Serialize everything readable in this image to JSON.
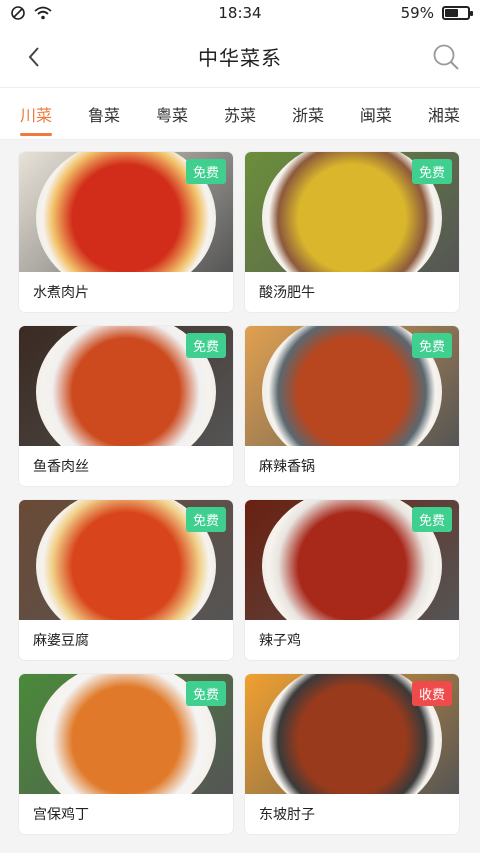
{
  "status": {
    "time": "18:34",
    "battery": "59%",
    "battery_level": 0.59
  },
  "header": {
    "title": "中华菜系"
  },
  "tabs": [
    {
      "label": "川菜",
      "active": true
    },
    {
      "label": "鲁菜"
    },
    {
      "label": "粤菜"
    },
    {
      "label": "苏菜"
    },
    {
      "label": "浙菜"
    },
    {
      "label": "闽菜"
    },
    {
      "label": "湘菜"
    }
  ],
  "dishes": [
    {
      "name": "水煮肉片",
      "badge": "免费",
      "badge_type": "free",
      "palette": [
        "#d22d1a",
        "#f2c36b",
        "#e8e2d8"
      ]
    },
    {
      "name": "酸汤肥牛",
      "badge": "免费",
      "badge_type": "free",
      "palette": [
        "#d9b62c",
        "#8c5a3c",
        "#6b8f3a"
      ]
    },
    {
      "name": "鱼香肉丝",
      "badge": "免费",
      "badge_type": "free",
      "palette": [
        "#cc4a1e",
        "#f0f0f0",
        "#3a2a22"
      ]
    },
    {
      "name": "麻辣香锅",
      "badge": "免费",
      "badge_type": "free",
      "palette": [
        "#b8461e",
        "#5b6870",
        "#e0a050"
      ]
    },
    {
      "name": "麻婆豆腐",
      "badge": "免费",
      "badge_type": "free",
      "palette": [
        "#d8441c",
        "#f1d18a",
        "#6a4a36"
      ]
    },
    {
      "name": "辣子鸡",
      "badge": "免费",
      "badge_type": "free",
      "palette": [
        "#a8281a",
        "#e8e4e0",
        "#6a2010"
      ]
    },
    {
      "name": "宫保鸡丁",
      "badge": "免费",
      "badge_type": "free",
      "palette": [
        "#e07a2a",
        "#f4f4f4",
        "#4a8a3a"
      ]
    },
    {
      "name": "东坡肘子",
      "badge": "收费",
      "badge_type": "paid",
      "palette": [
        "#9a3a1c",
        "#3a3a3a",
        "#f0a030"
      ]
    }
  ],
  "colors": {
    "accent": "#f07a3d",
    "free_badge": "#3fcf8e",
    "paid_badge": "#f04b4b"
  },
  "icons": {
    "back": "back-arrow-icon",
    "search": "search-icon"
  }
}
